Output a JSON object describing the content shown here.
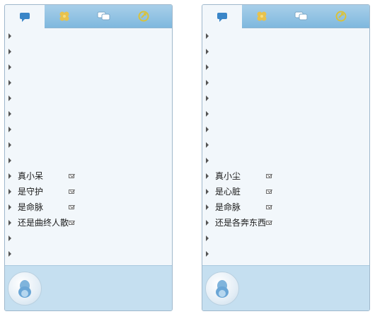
{
  "tabs": [
    {
      "icon": "chat-bubble-icon",
      "color": "#3a86c8"
    },
    {
      "icon": "clover-icon",
      "color": "#e2c04a"
    },
    {
      "icon": "group-chat-icon",
      "color": "#ffffff"
    },
    {
      "icon": "circular-arrow-icon",
      "color": "#d9c23a"
    }
  ],
  "panels": [
    {
      "rows": [
        {
          "name": ""
        },
        {
          "name": ""
        },
        {
          "name": ""
        },
        {
          "name": ""
        },
        {
          "name": ""
        },
        {
          "name": ""
        },
        {
          "name": ""
        },
        {
          "name": ""
        },
        {
          "name": ""
        },
        {
          "name": "真小呆",
          "mail": true
        },
        {
          "name": "是守护",
          "mail": true
        },
        {
          "name": "是命脉",
          "mail": true
        },
        {
          "name": "还是曲终人散",
          "mail": true
        },
        {
          "name": ""
        },
        {
          "name": ""
        }
      ]
    },
    {
      "rows": [
        {
          "name": ""
        },
        {
          "name": ""
        },
        {
          "name": ""
        },
        {
          "name": ""
        },
        {
          "name": ""
        },
        {
          "name": ""
        },
        {
          "name": ""
        },
        {
          "name": ""
        },
        {
          "name": ""
        },
        {
          "name": "真小尘",
          "mail": true
        },
        {
          "name": "是心脏",
          "mail": true
        },
        {
          "name": "是命脉",
          "mail": true
        },
        {
          "name": "还是各奔东西",
          "mail": true
        },
        {
          "name": ""
        },
        {
          "name": ""
        }
      ]
    }
  ],
  "avatar_icon": "qq-penguin-icon"
}
